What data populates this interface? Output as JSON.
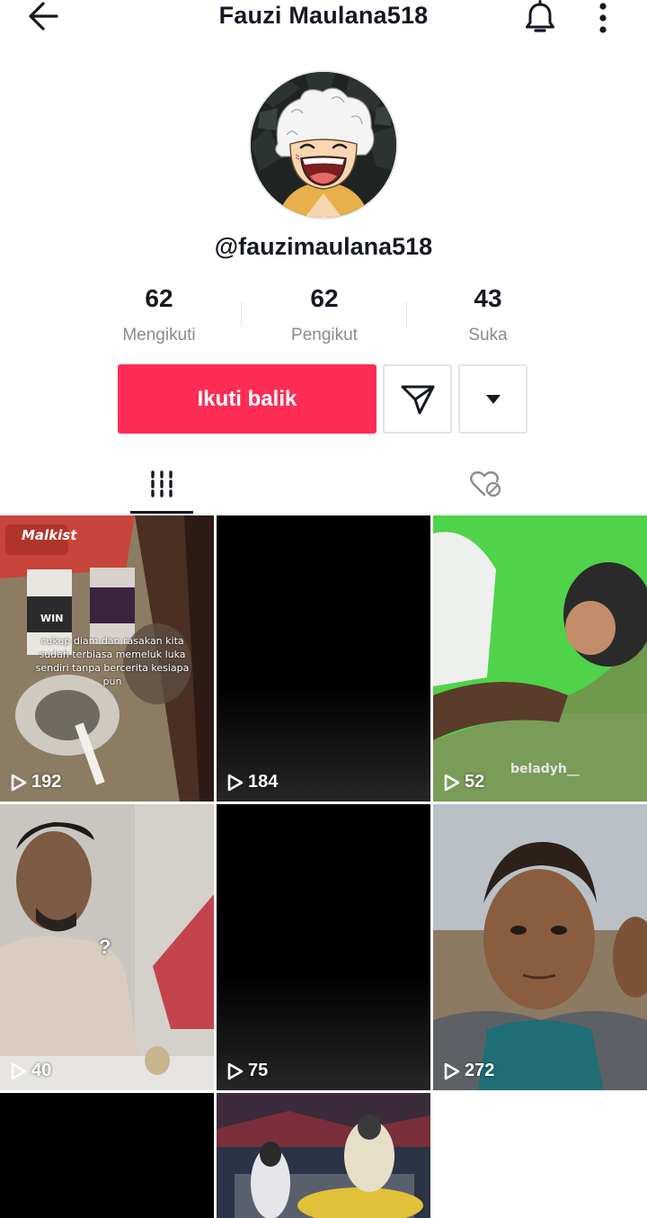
{
  "header": {
    "title": "Fauzi Maulana518",
    "back_icon": "arrow-left-icon",
    "bell_icon": "bell-icon",
    "more_icon": "more-vertical-icon"
  },
  "profile": {
    "username": "@fauzimaulana518",
    "avatar": "anime-avatar"
  },
  "stats": [
    {
      "value": "62",
      "label": "Mengikuti"
    },
    {
      "value": "62",
      "label": "Pengikut"
    },
    {
      "value": "43",
      "label": "Suka"
    }
  ],
  "actions": {
    "follow_label": "Ikuti balik",
    "message_icon": "send-icon",
    "dropdown_icon": "caret-down-icon",
    "accent_color": "#fe2c55"
  },
  "tabs": [
    {
      "name": "videos",
      "icon": "grid-icon",
      "active": true
    },
    {
      "name": "liked",
      "icon": "heart-lock-icon",
      "active": false
    }
  ],
  "videos": [
    {
      "views": "192",
      "caption": "cukup diam dan rasakan kita sudah terbiasa memeluk luka sendiri tanpa bercerita kesiapa pun",
      "brand": "Malkist",
      "pack": "WIN"
    },
    {
      "views": "184"
    },
    {
      "views": "52",
      "watermark": "beladyh__"
    },
    {
      "views": "40",
      "overlay": "?"
    },
    {
      "views": "75"
    },
    {
      "views": "272"
    },
    {
      "views": ""
    },
    {
      "views": ""
    }
  ]
}
